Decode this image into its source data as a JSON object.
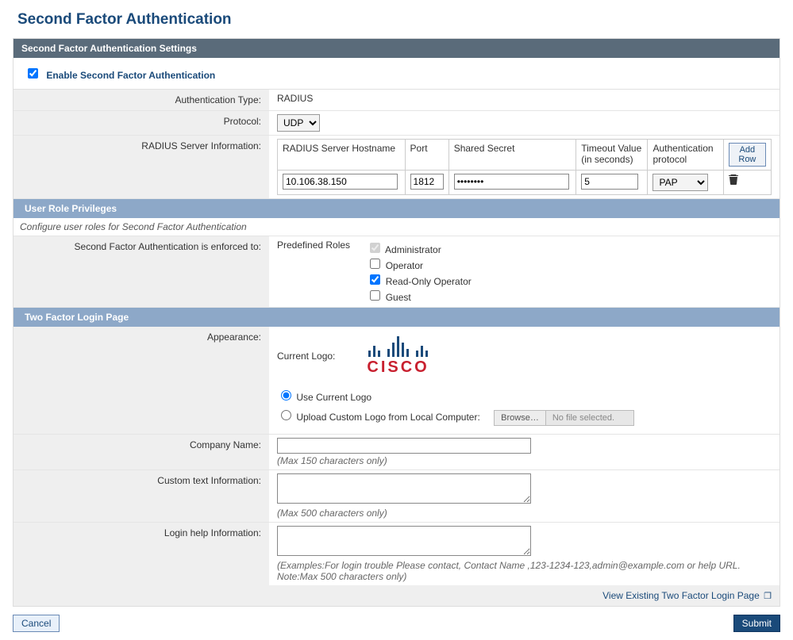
{
  "page_title": "Second Factor Authentication",
  "section_settings_title": "Second Factor Authentication Settings",
  "enable_label": "Enable Second Factor Authentication",
  "enable_checked": true,
  "auth_type_label": "Authentication Type:",
  "auth_type_value": "RADIUS",
  "protocol_label": "Protocol:",
  "protocol_value": "UDP",
  "radius_info_label": "RADIUS Server Information:",
  "radius_headers": {
    "hostname": "RADIUS Server Hostname",
    "port": "Port",
    "secret": "Shared Secret",
    "timeout": "Timeout Value (in seconds)",
    "authproto": "Authentication protocol",
    "add_row": "Add Row"
  },
  "radius_row": {
    "hostname": "10.106.38.150",
    "port": "1812",
    "secret": "••••••••",
    "timeout": "5",
    "authproto": "PAP"
  },
  "user_role_section": "User Role Privileges",
  "user_role_desc": "Configure user roles for Second Factor Authentication",
  "enforced_label": "Second Factor Authentication is enforced to:",
  "predefined_roles_label": "Predefined Roles",
  "roles": {
    "administrator": {
      "label": "Administrator",
      "checked": true,
      "disabled": true
    },
    "operator": {
      "label": "Operator",
      "checked": false,
      "disabled": false
    },
    "readonly": {
      "label": "Read-Only Operator",
      "checked": true,
      "disabled": false
    },
    "guest": {
      "label": "Guest",
      "checked": false,
      "disabled": false
    }
  },
  "login_page_section": "Two Factor Login Page",
  "appearance_label": "Appearance:",
  "current_logo_label": "Current Logo:",
  "logo_option_current": "Use Current Logo",
  "logo_option_upload": "Upload Custom Logo from Local Computer:",
  "browse_label": "Browse…",
  "no_file_text": "No file selected.",
  "company_name_label": "Company Name:",
  "company_name_hint": "(Max 150 characters only)",
  "custom_text_label": "Custom text Information:",
  "custom_text_hint": "(Max 500 characters only)",
  "login_help_label": "Login help Information:",
  "login_help_hint": "(Examples:For login trouble Please contact, Contact Name ,123-1234-123,admin@example.com or help URL. Note:Max 500 characters only)",
  "view_existing_link": "View Existing Two Factor Login Page",
  "cancel_label": "Cancel",
  "submit_label": "Submit",
  "cisco_text": "CISCO"
}
